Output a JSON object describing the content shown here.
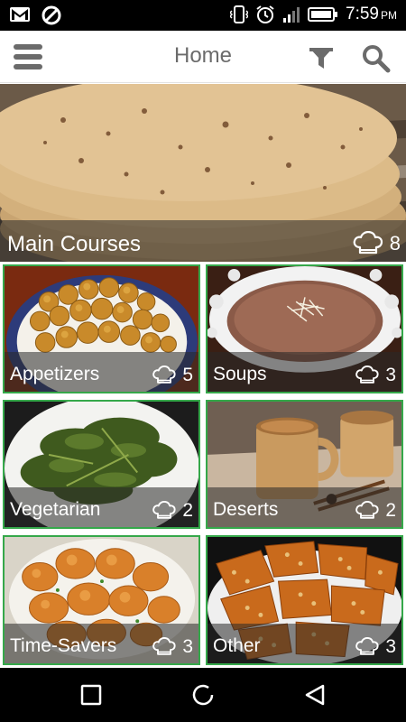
{
  "status_bar": {
    "time": "7:59",
    "ampm": "PM",
    "icons": [
      "gmail-icon",
      "blocked-icon",
      "phone-vibrate-icon",
      "alarm-icon",
      "signal-icon",
      "battery-icon"
    ]
  },
  "app_bar": {
    "title": "Home",
    "icons": [
      "menu-icon",
      "filter-icon",
      "search-icon"
    ]
  },
  "categories": {
    "hero": {
      "label": "Main Courses",
      "count": "8"
    },
    "items": [
      {
        "label": "Appetizers",
        "count": "5"
      },
      {
        "label": "Soups",
        "count": "3"
      },
      {
        "label": "Vegetarian",
        "count": "2"
      },
      {
        "label": "Deserts",
        "count": "2"
      },
      {
        "label": "Time-Savers",
        "count": "3"
      },
      {
        "label": "Other",
        "count": "3"
      }
    ]
  },
  "nav_bar": {
    "icons": [
      "recent-apps-icon",
      "home-icon",
      "back-icon"
    ]
  },
  "colors": {
    "tile_border": "#35a84a",
    "caption_overlay": "rgba(40,40,40,0.55)",
    "app_bar_text": "#6b6b6b"
  }
}
